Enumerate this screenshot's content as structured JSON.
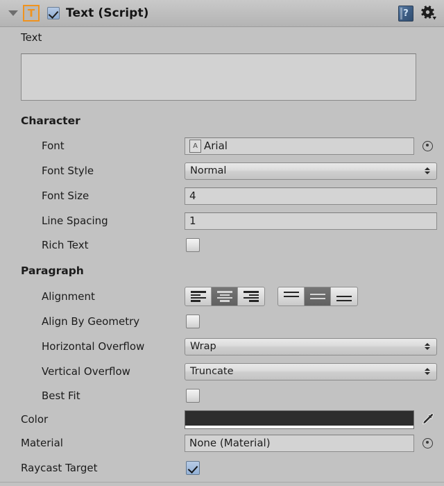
{
  "header": {
    "component_title": "Text (Script)",
    "script_icon_letter": "T",
    "enabled": true,
    "foldout_open": true,
    "help_icon": "help-book-icon",
    "help_glyph": "?",
    "settings_icon": "gear-icon"
  },
  "text_section": {
    "label": "Text",
    "value": "",
    "placeholder": ""
  },
  "character": {
    "section_label": "Character",
    "font": {
      "label": "Font",
      "value": "Arial",
      "asset_icon": "font-asset-icon"
    },
    "font_style": {
      "label": "Font Style",
      "value": "Normal"
    },
    "font_size": {
      "label": "Font Size",
      "value": "4"
    },
    "line_spacing": {
      "label": "Line Spacing",
      "value": "1"
    },
    "rich_text": {
      "label": "Rich Text",
      "checked": false
    }
  },
  "paragraph": {
    "section_label": "Paragraph",
    "alignment": {
      "label": "Alignment",
      "horizontal_selected": "center",
      "horizontal_options": [
        "left",
        "center",
        "right"
      ],
      "vertical_selected": "middle",
      "vertical_options": [
        "top",
        "middle",
        "bottom"
      ]
    },
    "align_by_geometry": {
      "label": "Align By Geometry",
      "checked": false
    },
    "horizontal_overflow": {
      "label": "Horizontal Overflow",
      "value": "Wrap"
    },
    "vertical_overflow": {
      "label": "Vertical Overflow",
      "value": "Truncate"
    },
    "best_fit": {
      "label": "Best Fit",
      "checked": false
    }
  },
  "appearance": {
    "color": {
      "label": "Color",
      "value": "#2D2D2D",
      "alpha_bar": "#FFFFFF",
      "eyedropper_icon": "eyedropper-icon"
    },
    "material": {
      "label": "Material",
      "value": "None (Material)"
    },
    "raycast_target": {
      "label": "Raycast Target",
      "checked": true
    }
  },
  "colors": {
    "panel_bg": "#C2C2C2",
    "accent_orange": "#F0931E",
    "checkbox_blue": "#93B1D6",
    "field_bg": "#D4D4D4"
  }
}
